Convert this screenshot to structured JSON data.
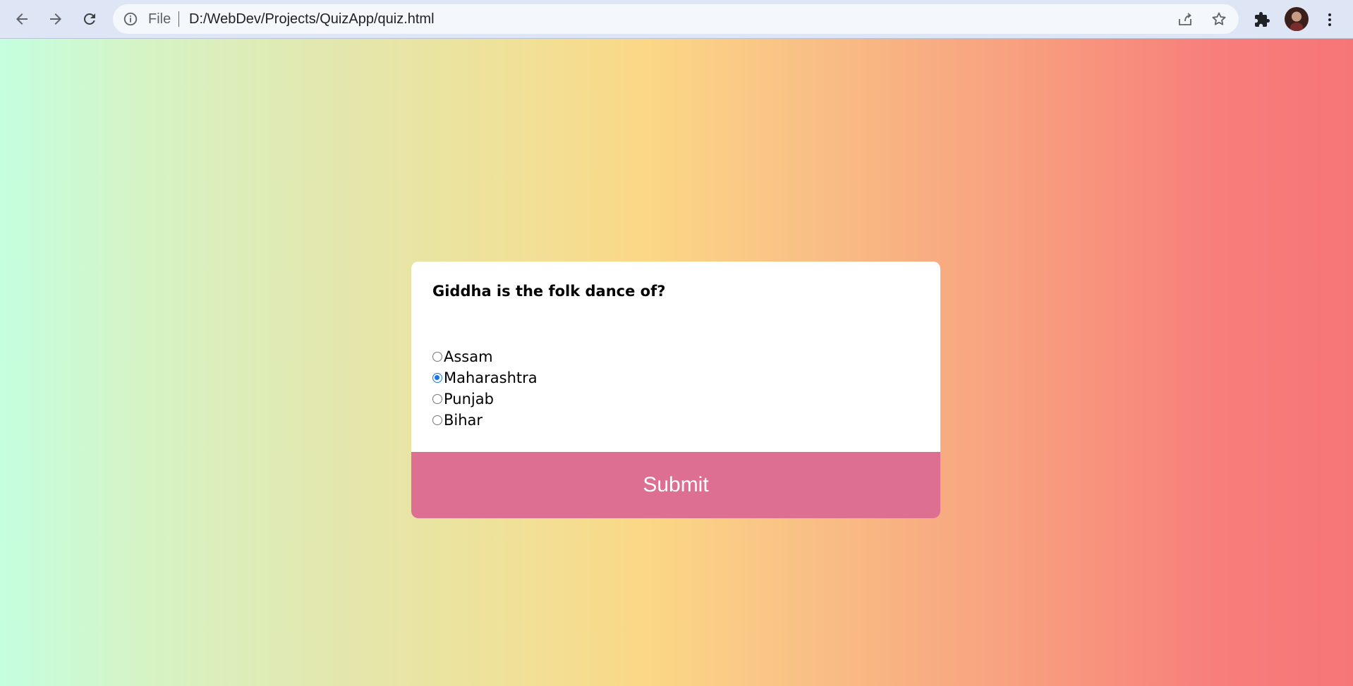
{
  "browser": {
    "back_icon": "arrow-left-icon",
    "forward_icon": "arrow-right-icon",
    "reload_icon": "reload-icon",
    "info_icon": "info-icon",
    "scheme_label": "File",
    "url": "D:/WebDev/Projects/QuizApp/quiz.html",
    "share_icon": "share-icon",
    "bookmark_icon": "star-icon",
    "extensions_icon": "puzzle-icon",
    "menu_icon": "kebab-menu-icon"
  },
  "quiz": {
    "question": "Giddha is the folk dance of?",
    "options": [
      {
        "label": "Assam",
        "checked": false
      },
      {
        "label": "Maharashtra",
        "checked": true
      },
      {
        "label": "Punjab",
        "checked": false
      },
      {
        "label": "Bihar",
        "checked": false
      }
    ],
    "submit_label": "Submit"
  },
  "colors": {
    "submit_bg": "#dd6f92",
    "radio_checked": "#1a73e8",
    "gradient_start": "#c4ffdf",
    "gradient_mid": "#fbd786",
    "gradient_end": "#f77577"
  }
}
